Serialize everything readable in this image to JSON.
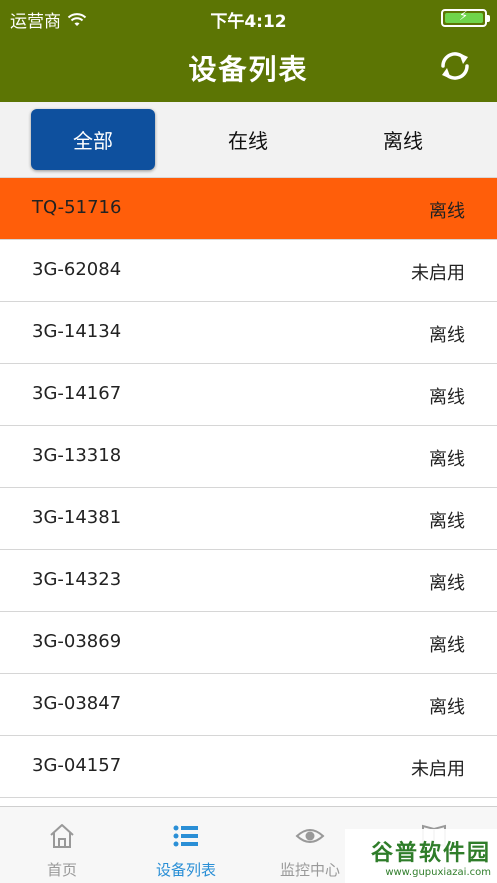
{
  "status_bar": {
    "carrier": "运营商",
    "time": "下午4:12",
    "battery_level": 1.0
  },
  "navbar": {
    "title": "设备列表",
    "refresh_icon": "refresh-icon"
  },
  "segments": [
    {
      "label": "全部",
      "active": true
    },
    {
      "label": "在线",
      "active": false
    },
    {
      "label": "离线",
      "active": false
    }
  ],
  "devices": [
    {
      "id": "TQ-51716",
      "status": "离线",
      "selected": true
    },
    {
      "id": "3G-62084",
      "status": "未启用"
    },
    {
      "id": "3G-14134",
      "status": "离线"
    },
    {
      "id": "3G-14167",
      "status": "离线"
    },
    {
      "id": "3G-13318",
      "status": "离线"
    },
    {
      "id": "3G-14381",
      "status": "离线"
    },
    {
      "id": "3G-14323",
      "status": "离线"
    },
    {
      "id": "3G-03869",
      "status": "离线"
    },
    {
      "id": "3G-03847",
      "status": "离线"
    },
    {
      "id": "3G-04157",
      "status": "未启用"
    }
  ],
  "tabs": [
    {
      "label": "首页",
      "icon": "home-icon",
      "active": false
    },
    {
      "label": "设备列表",
      "icon": "list-icon",
      "active": true
    },
    {
      "label": "监控中心",
      "icon": "eye-icon",
      "active": false
    },
    {
      "label": "",
      "icon": "book-icon",
      "active": false
    }
  ],
  "watermark": {
    "main": "谷普软件园",
    "sub": "www.gupuxiazai.com"
  },
  "colors": {
    "header": "#5c7504",
    "selected_row": "#ff5e0a",
    "segment_active": "#0e509e",
    "tab_active": "#2a8fd6"
  }
}
